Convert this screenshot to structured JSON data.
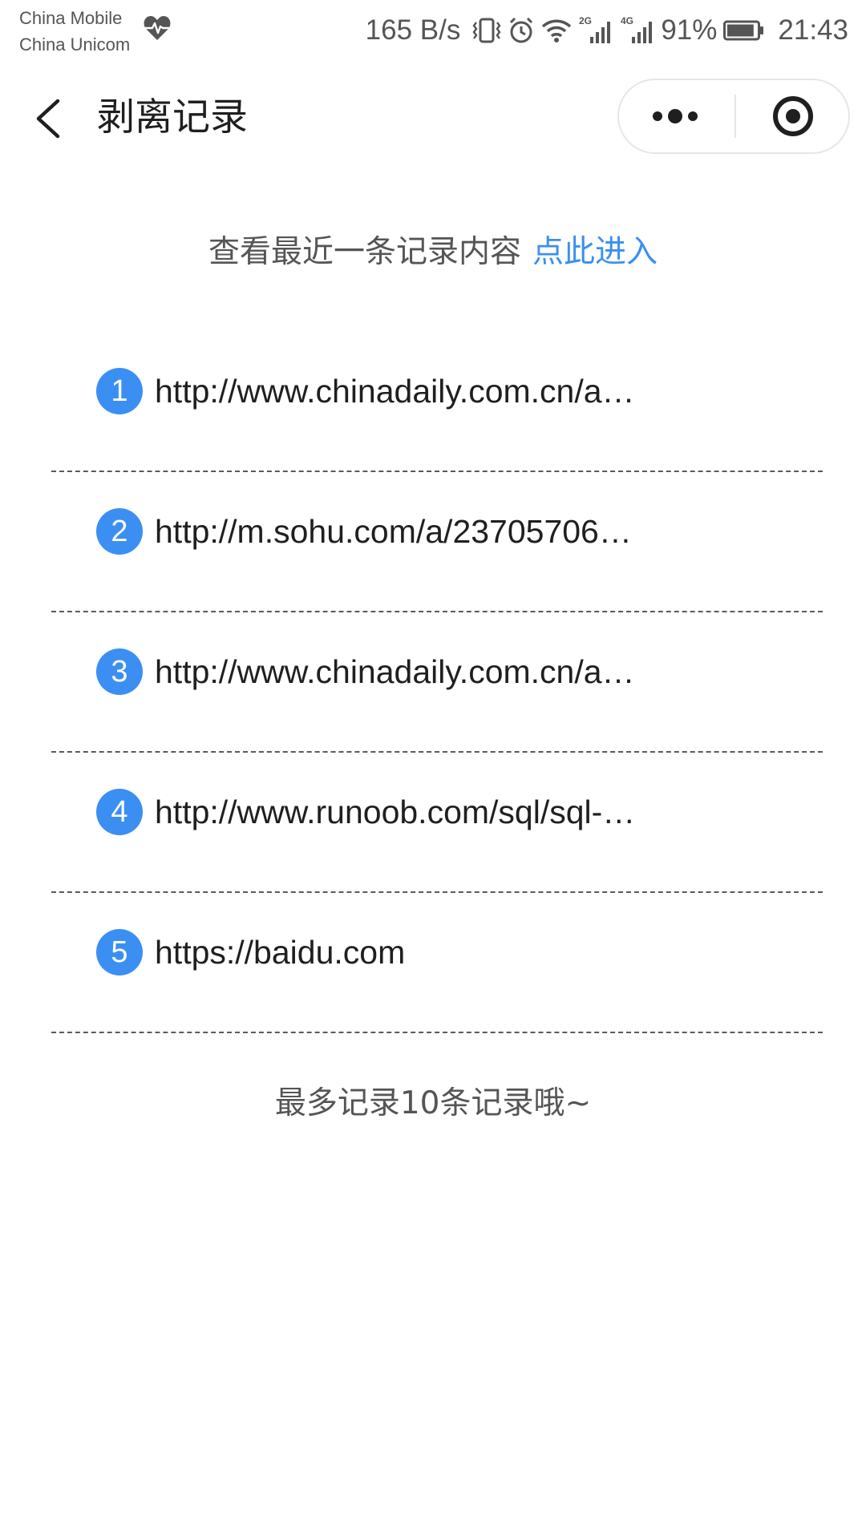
{
  "status_bar": {
    "carrier_1": "China Mobile",
    "carrier_2": "China Unicom",
    "net_speed": "165 B/s",
    "network_2g": "2G",
    "network_4g": "4G",
    "battery": "91%",
    "battery_level": 0.91,
    "time": "21:43",
    "icons": [
      "heart-rate-icon",
      "vibrate-icon",
      "alarm-icon",
      "wifi-icon",
      "signal-2g-icon",
      "signal-4g-icon",
      "battery-icon"
    ]
  },
  "nav": {
    "title": "剥离记录",
    "back_icon": "chevron-left-icon",
    "more_icon": "more-dots-icon",
    "close_icon": "target-close-icon"
  },
  "recent": {
    "text": "查看最近一条记录内容",
    "link": "点此进入"
  },
  "records": [
    {
      "num": "1",
      "url": "http://www.chinadaily.com.cn/a…"
    },
    {
      "num": "2",
      "url": "http://m.sohu.com/a/23705706…"
    },
    {
      "num": "3",
      "url": "http://www.chinadaily.com.cn/a…"
    },
    {
      "num": "4",
      "url": "http://www.runoob.com/sql/sql-…"
    },
    {
      "num": "5",
      "url": "https://baidu.com"
    }
  ],
  "footer": {
    "note": "最多记录10条记录哦~"
  },
  "colors": {
    "accent": "#3b8ff2",
    "text_primary": "#1f1f1f",
    "text_secondary": "#555555",
    "background": "#ffffff"
  }
}
